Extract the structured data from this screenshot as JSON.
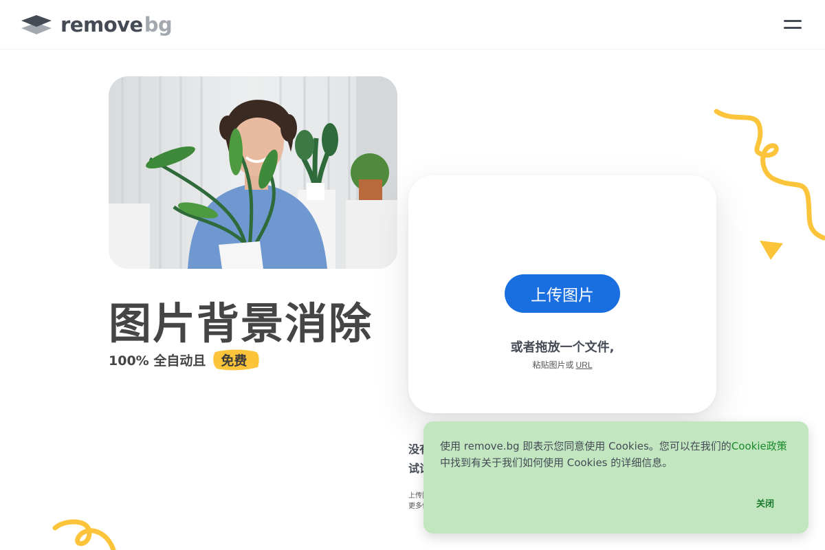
{
  "header": {
    "logo_text_primary": "remove",
    "logo_text_secondary": "bg",
    "menu_icon": "hamburger-menu-icon"
  },
  "hero": {
    "photo_description_icon": "hero-photo",
    "title": "图片背景消除",
    "subtitle_prefix": "100% 全自动且",
    "free_badge": "免费"
  },
  "upload": {
    "button_label": "上传图片",
    "drop_text": "或者拖放一个文件,",
    "paste_prefix": "粘贴图片或",
    "url_link": "URL"
  },
  "below_card": {
    "line1": "没有",
    "line2": "试试",
    "small1": "上传图",
    "small2": "更多信"
  },
  "cookie_banner": {
    "text_before_link": "使用 remove.bg 即表示您同意使用 Cookies。您可以在我们的",
    "link_text": "Cookie政策",
    "text_after_link": "中找到有关于我们如何使用 Cookies 的详细信息。",
    "close_label": "关闭"
  },
  "colors": {
    "primary_blue": "#1a6fe0",
    "heading_gray": "#454545",
    "accent_yellow": "#fcc43a",
    "cookie_bg": "#c1e6c0",
    "cookie_link": "#1a8a2a"
  }
}
